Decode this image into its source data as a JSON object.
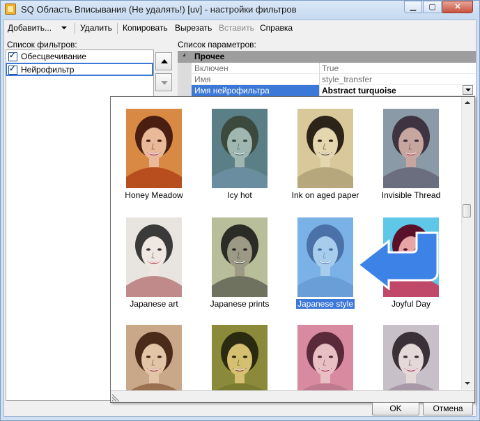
{
  "window": {
    "title": "SQ Область Вписывания (Не удалять!) [uv] - настройки фильтров"
  },
  "menu": {
    "add": "Добавить...",
    "delete": "Удалить",
    "copy": "Копировать",
    "cut": "Вырезать",
    "paste": "Вставить",
    "help": "Справка"
  },
  "filters": {
    "label": "Список фильтров:",
    "items": [
      {
        "label": "Обесцвечивание",
        "checked": true
      },
      {
        "label": "Нейрофильтр",
        "checked": true,
        "selected": true
      }
    ]
  },
  "params": {
    "label": "Список параметров:",
    "category": "Прочее",
    "rows": [
      {
        "name": "Включен",
        "value": "True"
      },
      {
        "name": "Имя",
        "value": "style_transfer"
      },
      {
        "name": "Имя нейрофильтра",
        "value": "Abstract turquoise",
        "selected": true
      }
    ]
  },
  "styles": [
    {
      "label": "Honey Meadow",
      "bg": "#d88a44",
      "skin": "#e9b99a",
      "hair": "#4a1e10",
      "shirt": "#b84d1d",
      "lips": "#b8305a"
    },
    {
      "label": "Icy hot",
      "bg": "#5a7f86",
      "skin": "#9fb7b0",
      "hair": "#3c4a3e",
      "shirt": "#6a8ea0",
      "lips": "#3a6a70"
    },
    {
      "label": "Ink on aged paper",
      "bg": "#d9c89a",
      "skin": "#e4d6ae",
      "hair": "#2c2418",
      "shirt": "#b7a77c",
      "lips": "#5a4a30"
    },
    {
      "label": "Invisible Thread",
      "bg": "#8a9aa6",
      "skin": "#c8a6a0",
      "hair": "#3e3340",
      "shirt": "#6b6e7e",
      "lips": "#a84050"
    },
    {
      "label": "Japanese art",
      "bg": "#e8e4e0",
      "skin": "#efe7e2",
      "hair": "#3a3a3a",
      "shirt": "#c08a8a",
      "lips": "#b04040"
    },
    {
      "label": "Japanese prints",
      "bg": "#b8bd9a",
      "skin": "#9c9a84",
      "hair": "#2c2c26",
      "shirt": "#6e725e",
      "lips": "#3c3c34"
    },
    {
      "label": "Japanese style",
      "bg": "#7ab2e8",
      "skin": "#a8cdec",
      "hair": "#4a72a8",
      "shirt": "#6a9ed6",
      "lips": "#4a78b8",
      "selected": true
    },
    {
      "label": "Joyful Day",
      "bg": "#5fc8e8",
      "skin": "#e6a6a6",
      "hair": "#5a1028",
      "shirt": "#c04868",
      "lips": "#a02848"
    },
    {
      "label": "",
      "bg": "#c8a888",
      "skin": "#e2c4a6",
      "hair": "#4a2a18",
      "shirt": "#9a7050",
      "lips": "#a04040"
    },
    {
      "label": "",
      "bg": "#8a8a3a",
      "skin": "#d4c070",
      "hair": "#2a2a10",
      "shirt": "#7a7a30",
      "lips": "#8a4020"
    },
    {
      "label": "",
      "bg": "#d88aa0",
      "skin": "#e8c0c4",
      "hair": "#5a2a3a",
      "shirt": "#c07a90",
      "lips": "#b03050"
    },
    {
      "label": "",
      "bg": "#c8c0c8",
      "skin": "#e4d8d8",
      "hair": "#3a3038",
      "shirt": "#a898a8",
      "lips": "#a04060"
    }
  ],
  "buttons": {
    "ok": "OK",
    "cancel": "Отмена"
  },
  "colors": {
    "selection": "#3b78d8",
    "arrow_fill": "#3d82e6",
    "category_bg": "#9e9e9e"
  }
}
